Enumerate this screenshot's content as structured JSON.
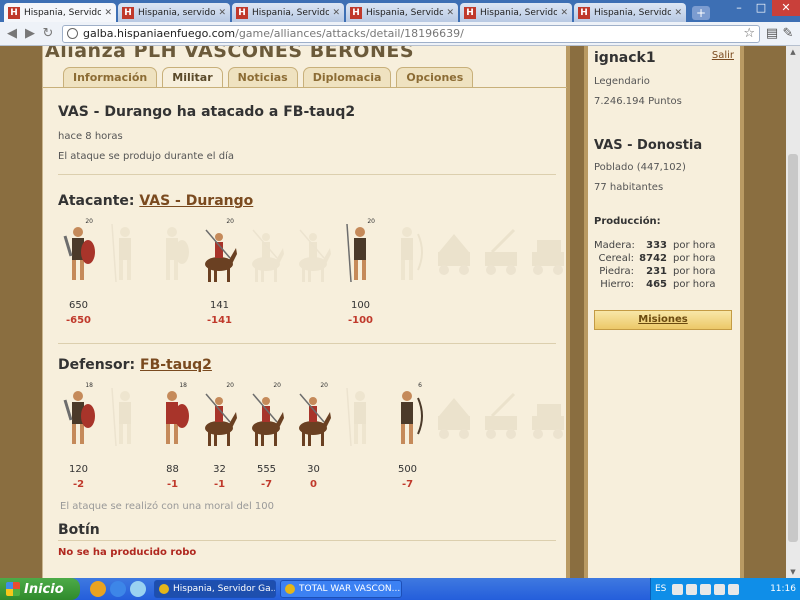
{
  "browser": {
    "tabs": [
      {
        "icon": "H",
        "label": "Hispania, Servidor G"
      },
      {
        "icon": "H",
        "label": "Hispania, servidor G"
      },
      {
        "icon": "H",
        "label": "Hispania, Servidor G"
      },
      {
        "icon": "H",
        "label": "Hispania, Servidor G"
      },
      {
        "icon": "H",
        "label": "Hispania, Servidor G"
      },
      {
        "icon": "H",
        "label": "Hispania, Servidor G"
      }
    ],
    "window_controls": {
      "minimize": "–",
      "maximize": "□",
      "close": "✕"
    },
    "url_host": "galba.hispaniaenfuego.com",
    "url_path": "/game/alliances/attacks/detail/18196639/"
  },
  "alliance": {
    "title": "Alianza PLH VASCONES BERONES",
    "tabs": [
      {
        "label": "Información",
        "active": false
      },
      {
        "label": "Militar",
        "active": true
      },
      {
        "label": "Noticias",
        "active": false
      },
      {
        "label": "Diplomacia",
        "active": false
      },
      {
        "label": "Opciones",
        "active": false
      }
    ]
  },
  "report": {
    "title": "VAS - Durango ha atacado a FB-tauq2",
    "time_ago": "hace 8 horas",
    "description": "El ataque se produjo durante el día",
    "attacker": {
      "label": "Atacante:",
      "name": "VAS - Durango",
      "units": [
        {
          "icon": "shield-warrior-icon",
          "level": "20",
          "present": true,
          "count": "650",
          "loss": "-650"
        },
        {
          "icon": "javelin-warrior-icon",
          "level": "",
          "present": false,
          "count": "",
          "loss": ""
        },
        {
          "icon": "legionary-icon",
          "level": "",
          "present": false,
          "count": "",
          "loss": ""
        },
        {
          "icon": "cavalry-icon",
          "level": "20",
          "present": true,
          "count": "141",
          "loss": "-141"
        },
        {
          "icon": "light-cavalry-icon",
          "level": "",
          "present": false,
          "count": "",
          "loss": ""
        },
        {
          "icon": "lancer-cavalry-icon",
          "level": "",
          "present": false,
          "count": "",
          "loss": ""
        },
        {
          "icon": "spearman-icon",
          "level": "20",
          "present": true,
          "count": "100",
          "loss": "-100"
        },
        {
          "icon": "archer-icon",
          "level": "",
          "present": false,
          "count": "",
          "loss": ""
        },
        {
          "icon": "ram-icon",
          "level": "",
          "present": false,
          "count": "",
          "loss": ""
        },
        {
          "icon": "catapult-icon",
          "level": "",
          "present": false,
          "count": "",
          "loss": ""
        },
        {
          "icon": "ox-cart-icon",
          "level": "",
          "present": false,
          "count": "",
          "loss": ""
        }
      ]
    },
    "defender": {
      "label": "Defensor:",
      "name": "FB-tauq2",
      "units": [
        {
          "icon": "shield-warrior-icon",
          "level": "18",
          "present": true,
          "count": "120",
          "loss": "-2"
        },
        {
          "icon": "javelin-warrior-icon",
          "level": "",
          "present": false,
          "count": "",
          "loss": ""
        },
        {
          "icon": "legionary-icon",
          "level": "18",
          "present": true,
          "count": "88",
          "loss": "-1"
        },
        {
          "icon": "cavalry-icon",
          "level": "20",
          "present": true,
          "count": "32",
          "loss": "-1"
        },
        {
          "icon": "light-cavalry-icon",
          "level": "20",
          "present": true,
          "count": "555",
          "loss": "-7"
        },
        {
          "icon": "lancer-cavalry-icon",
          "level": "20",
          "present": true,
          "count": "30",
          "loss": "0"
        },
        {
          "icon": "spearman-icon",
          "level": "",
          "present": false,
          "count": "",
          "loss": ""
        },
        {
          "icon": "archer-icon",
          "level": "6",
          "present": true,
          "count": "500",
          "loss": "-7"
        },
        {
          "icon": "ram-icon",
          "level": "",
          "present": false,
          "count": "",
          "loss": ""
        },
        {
          "icon": "catapult-icon",
          "level": "",
          "present": false,
          "count": "",
          "loss": ""
        },
        {
          "icon": "ox-cart-icon",
          "level": "",
          "present": false,
          "count": "",
          "loss": ""
        }
      ]
    },
    "moral": "El ataque se realizó con una moral del 100",
    "loot_heading": "Botín",
    "loot_text": "No se ha producido robo"
  },
  "sidebar": {
    "player": "ignack1",
    "logout": "Salir",
    "rank": "Legendario",
    "points": "7.246.194 Puntos",
    "town": "VAS - Donostia",
    "coords": "Poblado (447,102)",
    "population": "77 habitantes",
    "production_heading": "Producción:",
    "production": [
      {
        "label": "Madera:",
        "value": "333",
        "unit": "por hora"
      },
      {
        "label": "Cereal:",
        "value": "8742",
        "unit": "por hora"
      },
      {
        "label": "Piedra:",
        "value": "231",
        "unit": "por hora"
      },
      {
        "label": "Hierro:",
        "value": "465",
        "unit": "por hora"
      }
    ],
    "missions_button": "Misiones"
  },
  "taskbar": {
    "start": "Inicio",
    "tasks": [
      {
        "label": "Hispania, Servidor Ga...",
        "active": true
      },
      {
        "label": "TOTAL WAR VASCON...",
        "active": false
      }
    ],
    "lang": "ES",
    "clock": "11:16"
  }
}
